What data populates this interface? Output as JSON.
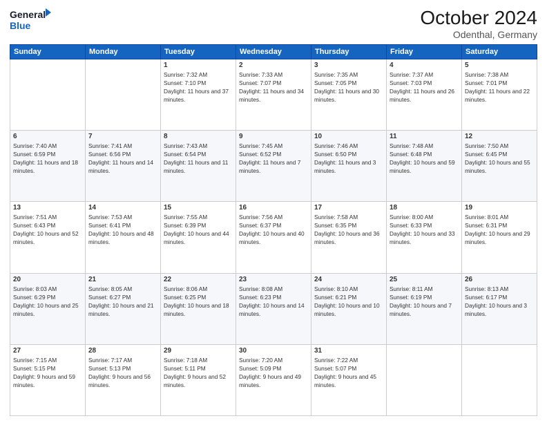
{
  "header": {
    "logo_line1": "General",
    "logo_line2": "Blue",
    "month": "October 2024",
    "location": "Odenthal, Germany"
  },
  "weekdays": [
    "Sunday",
    "Monday",
    "Tuesday",
    "Wednesday",
    "Thursday",
    "Friday",
    "Saturday"
  ],
  "weeks": [
    [
      {
        "day": "",
        "sunrise": "",
        "sunset": "",
        "daylight": ""
      },
      {
        "day": "",
        "sunrise": "",
        "sunset": "",
        "daylight": ""
      },
      {
        "day": "1",
        "sunrise": "Sunrise: 7:32 AM",
        "sunset": "Sunset: 7:10 PM",
        "daylight": "Daylight: 11 hours and 37 minutes."
      },
      {
        "day": "2",
        "sunrise": "Sunrise: 7:33 AM",
        "sunset": "Sunset: 7:07 PM",
        "daylight": "Daylight: 11 hours and 34 minutes."
      },
      {
        "day": "3",
        "sunrise": "Sunrise: 7:35 AM",
        "sunset": "Sunset: 7:05 PM",
        "daylight": "Daylight: 11 hours and 30 minutes."
      },
      {
        "day": "4",
        "sunrise": "Sunrise: 7:37 AM",
        "sunset": "Sunset: 7:03 PM",
        "daylight": "Daylight: 11 hours and 26 minutes."
      },
      {
        "day": "5",
        "sunrise": "Sunrise: 7:38 AM",
        "sunset": "Sunset: 7:01 PM",
        "daylight": "Daylight: 11 hours and 22 minutes."
      }
    ],
    [
      {
        "day": "6",
        "sunrise": "Sunrise: 7:40 AM",
        "sunset": "Sunset: 6:59 PM",
        "daylight": "Daylight: 11 hours and 18 minutes."
      },
      {
        "day": "7",
        "sunrise": "Sunrise: 7:41 AM",
        "sunset": "Sunset: 6:56 PM",
        "daylight": "Daylight: 11 hours and 14 minutes."
      },
      {
        "day": "8",
        "sunrise": "Sunrise: 7:43 AM",
        "sunset": "Sunset: 6:54 PM",
        "daylight": "Daylight: 11 hours and 11 minutes."
      },
      {
        "day": "9",
        "sunrise": "Sunrise: 7:45 AM",
        "sunset": "Sunset: 6:52 PM",
        "daylight": "Daylight: 11 hours and 7 minutes."
      },
      {
        "day": "10",
        "sunrise": "Sunrise: 7:46 AM",
        "sunset": "Sunset: 6:50 PM",
        "daylight": "Daylight: 11 hours and 3 minutes."
      },
      {
        "day": "11",
        "sunrise": "Sunrise: 7:48 AM",
        "sunset": "Sunset: 6:48 PM",
        "daylight": "Daylight: 10 hours and 59 minutes."
      },
      {
        "day": "12",
        "sunrise": "Sunrise: 7:50 AM",
        "sunset": "Sunset: 6:45 PM",
        "daylight": "Daylight: 10 hours and 55 minutes."
      }
    ],
    [
      {
        "day": "13",
        "sunrise": "Sunrise: 7:51 AM",
        "sunset": "Sunset: 6:43 PM",
        "daylight": "Daylight: 10 hours and 52 minutes."
      },
      {
        "day": "14",
        "sunrise": "Sunrise: 7:53 AM",
        "sunset": "Sunset: 6:41 PM",
        "daylight": "Daylight: 10 hours and 48 minutes."
      },
      {
        "day": "15",
        "sunrise": "Sunrise: 7:55 AM",
        "sunset": "Sunset: 6:39 PM",
        "daylight": "Daylight: 10 hours and 44 minutes."
      },
      {
        "day": "16",
        "sunrise": "Sunrise: 7:56 AM",
        "sunset": "Sunset: 6:37 PM",
        "daylight": "Daylight: 10 hours and 40 minutes."
      },
      {
        "day": "17",
        "sunrise": "Sunrise: 7:58 AM",
        "sunset": "Sunset: 6:35 PM",
        "daylight": "Daylight: 10 hours and 36 minutes."
      },
      {
        "day": "18",
        "sunrise": "Sunrise: 8:00 AM",
        "sunset": "Sunset: 6:33 PM",
        "daylight": "Daylight: 10 hours and 33 minutes."
      },
      {
        "day": "19",
        "sunrise": "Sunrise: 8:01 AM",
        "sunset": "Sunset: 6:31 PM",
        "daylight": "Daylight: 10 hours and 29 minutes."
      }
    ],
    [
      {
        "day": "20",
        "sunrise": "Sunrise: 8:03 AM",
        "sunset": "Sunset: 6:29 PM",
        "daylight": "Daylight: 10 hours and 25 minutes."
      },
      {
        "day": "21",
        "sunrise": "Sunrise: 8:05 AM",
        "sunset": "Sunset: 6:27 PM",
        "daylight": "Daylight: 10 hours and 21 minutes."
      },
      {
        "day": "22",
        "sunrise": "Sunrise: 8:06 AM",
        "sunset": "Sunset: 6:25 PM",
        "daylight": "Daylight: 10 hours and 18 minutes."
      },
      {
        "day": "23",
        "sunrise": "Sunrise: 8:08 AM",
        "sunset": "Sunset: 6:23 PM",
        "daylight": "Daylight: 10 hours and 14 minutes."
      },
      {
        "day": "24",
        "sunrise": "Sunrise: 8:10 AM",
        "sunset": "Sunset: 6:21 PM",
        "daylight": "Daylight: 10 hours and 10 minutes."
      },
      {
        "day": "25",
        "sunrise": "Sunrise: 8:11 AM",
        "sunset": "Sunset: 6:19 PM",
        "daylight": "Daylight: 10 hours and 7 minutes."
      },
      {
        "day": "26",
        "sunrise": "Sunrise: 8:13 AM",
        "sunset": "Sunset: 6:17 PM",
        "daylight": "Daylight: 10 hours and 3 minutes."
      }
    ],
    [
      {
        "day": "27",
        "sunrise": "Sunrise: 7:15 AM",
        "sunset": "Sunset: 5:15 PM",
        "daylight": "Daylight: 9 hours and 59 minutes."
      },
      {
        "day": "28",
        "sunrise": "Sunrise: 7:17 AM",
        "sunset": "Sunset: 5:13 PM",
        "daylight": "Daylight: 9 hours and 56 minutes."
      },
      {
        "day": "29",
        "sunrise": "Sunrise: 7:18 AM",
        "sunset": "Sunset: 5:11 PM",
        "daylight": "Daylight: 9 hours and 52 minutes."
      },
      {
        "day": "30",
        "sunrise": "Sunrise: 7:20 AM",
        "sunset": "Sunset: 5:09 PM",
        "daylight": "Daylight: 9 hours and 49 minutes."
      },
      {
        "day": "31",
        "sunrise": "Sunrise: 7:22 AM",
        "sunset": "Sunset: 5:07 PM",
        "daylight": "Daylight: 9 hours and 45 minutes."
      },
      {
        "day": "",
        "sunrise": "",
        "sunset": "",
        "daylight": ""
      },
      {
        "day": "",
        "sunrise": "",
        "sunset": "",
        "daylight": ""
      }
    ]
  ]
}
